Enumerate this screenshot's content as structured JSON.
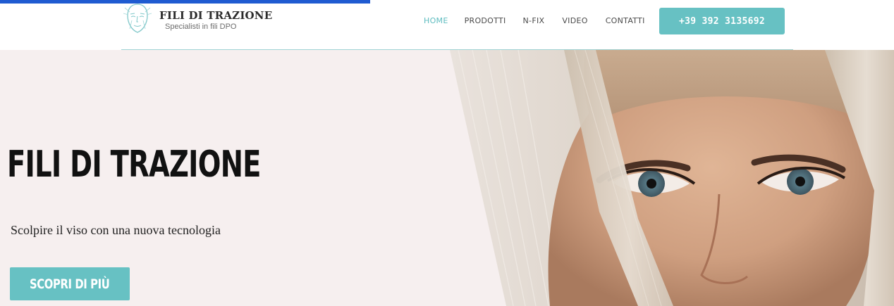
{
  "header": {
    "brand_name": "FILI DI TRAZIONE",
    "brand_tagline": "Specialisti in fili DPO",
    "nav": [
      {
        "label": "HOME",
        "active": true
      },
      {
        "label": "PRODOTTI",
        "active": false
      },
      {
        "label": "N-FIX",
        "active": false
      },
      {
        "label": "VIDEO",
        "active": false
      },
      {
        "label": "CONTATTI",
        "active": false
      }
    ],
    "phone_button": "+39 392 3135692"
  },
  "hero": {
    "title": "FILI DI TRAZIONE",
    "subtitle": "Scolpire il viso con una nuova tecnologia",
    "button_label": "SCOPRI DI PIÙ"
  },
  "colors": {
    "accent": "#67c1c3",
    "nav_active": "#5dbcbf",
    "hero_background": "#f6efef",
    "top_strip": "#1f5bd1"
  },
  "icons": {
    "logo": "face-outline-icon"
  }
}
